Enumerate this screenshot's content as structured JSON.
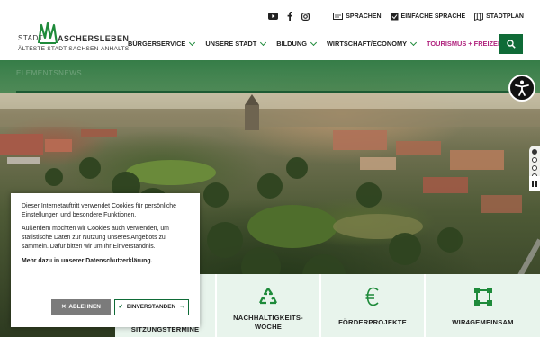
{
  "header": {
    "logo": {
      "stadt": "STADT",
      "name": "ASCHERSLEBEN",
      "subtitle": "ÄLTESTE STADT SACHSEN-ANHALTS"
    },
    "social": [
      "youtube-icon",
      "facebook-icon",
      "instagram-icon"
    ],
    "top_links": {
      "languages": "SPRACHEN",
      "simple_language": "EINFACHE SPRACHE",
      "city_map": "STADTPLAN"
    },
    "nav": [
      {
        "label": "BÜRGERSERVICE"
      },
      {
        "label": "UNSERE STADT"
      },
      {
        "label": "BILDUNG"
      },
      {
        "label": "WIRTSCHAFT/ECONOMY"
      },
      {
        "label": "TOURISMUS + FREIZEIT"
      }
    ],
    "search_icon": "search-icon"
  },
  "hero": {
    "banner_text": "ELEMENTSNEWS",
    "slider_total": 4,
    "slider_active": 1
  },
  "quick_links": [
    {
      "label": "",
      "icon": "calendar-icon"
    },
    {
      "label": "SITZUNGSTERMINE",
      "icon": "meeting-icon"
    },
    {
      "label": "NACHHALTIGKEITS-\nWOCHE",
      "icon": "recycle-icon"
    },
    {
      "label": "FÖRDERPROJEKTE",
      "icon": "euro-icon"
    },
    {
      "label": "WIR4GEMEINSAM",
      "icon": "network-icon"
    }
  ],
  "cookie": {
    "text1": "Dieser Internetauftritt verwendet Cookies für persönliche Einstellungen und besondere Funktionen.",
    "text2": "Außerdem möchten wir Cookies auch verwenden, um statistische Daten zur Nutzung unseres Angebots zu sammeln. Dafür bitten wir um Ihr Einverständnis.",
    "privacy": "Mehr dazu in unserer Datenschutzerklärung.",
    "decline": "ABLEHNEN",
    "accept": "EINVERSTANDEN"
  },
  "colors": {
    "brand_green": "#0f6b37",
    "tourism_magenta": "#b0237e",
    "quicklink_bg": "#e8f4ec"
  }
}
